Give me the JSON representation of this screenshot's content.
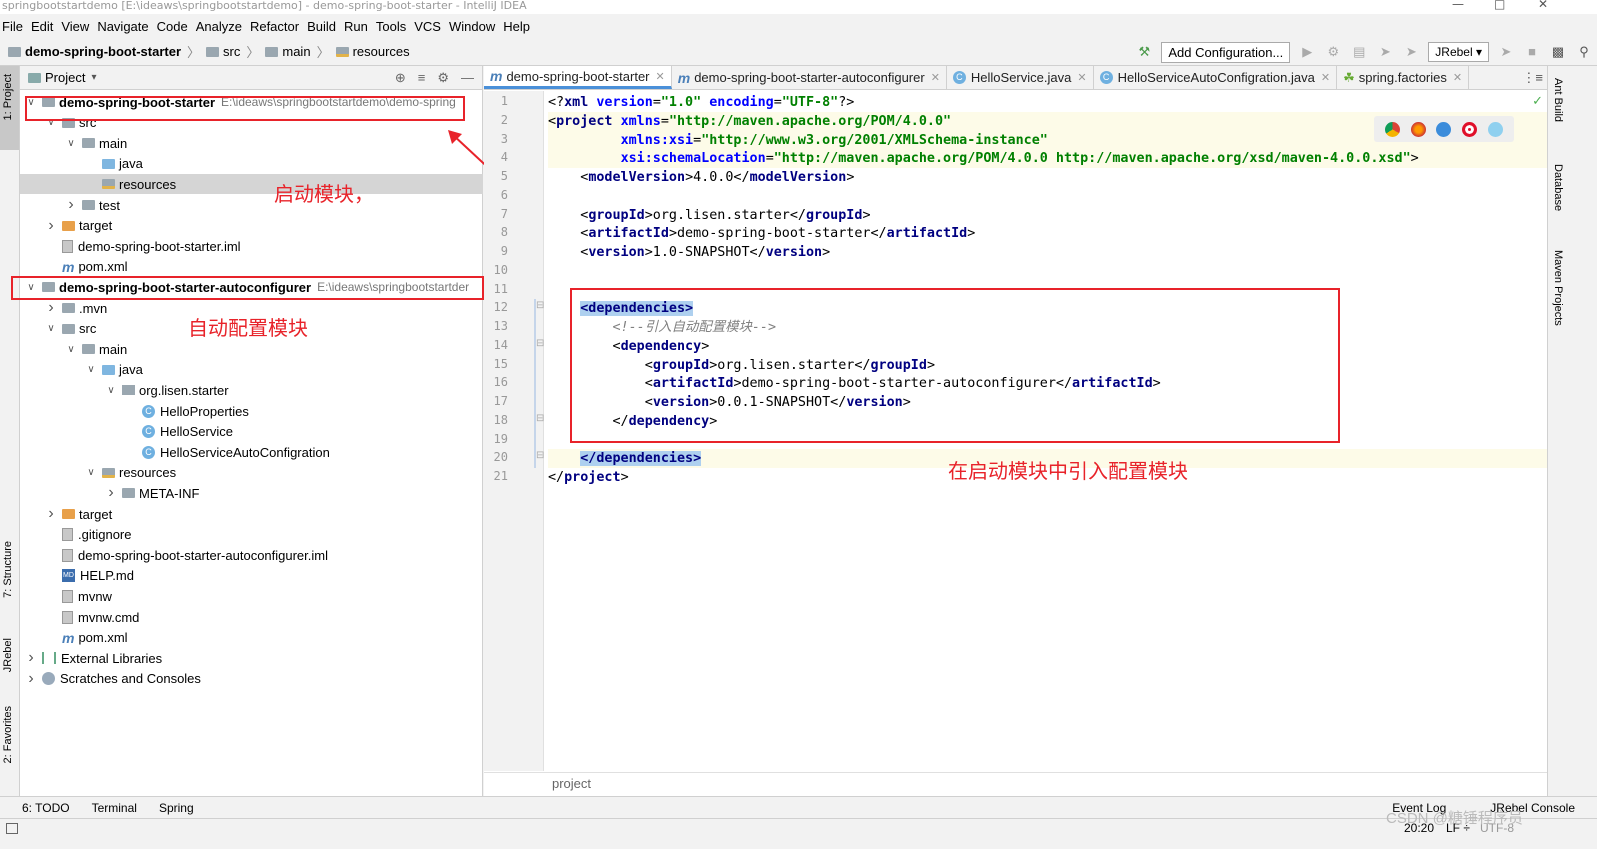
{
  "window": {
    "title": "springbootstartdemo [E:\\ideaws\\springbootstartdemo] - demo-spring-boot-starter - IntelliJ IDEA"
  },
  "menu": [
    "File",
    "Edit",
    "View",
    "Navigate",
    "Code",
    "Analyze",
    "Refactor",
    "Build",
    "Run",
    "Tools",
    "VCS",
    "Window",
    "Help"
  ],
  "breadcrumb": [
    "demo-spring-boot-starter",
    "src",
    "main",
    "resources"
  ],
  "toolbar": {
    "add_config": "Add Configuration...",
    "jrebel": "JRebel"
  },
  "side": {
    "project": "1: Project",
    "structure": "7: Structure",
    "jrebel": "JRebel",
    "favorites": "2: Favorites",
    "ant": "Ant Build",
    "database": "Database",
    "maven": "Maven Projects"
  },
  "project_panel": {
    "title": "Project"
  },
  "tree": [
    {
      "label": "demo-spring-boot-starter",
      "path": "E:\\ideaws\\springbootstartdemo\\demo-spring",
      "arrow": "v",
      "icon": "module",
      "bold": true
    },
    {
      "label": "src",
      "arrow": "v",
      "icon": "folder"
    },
    {
      "label": "main",
      "arrow": "v",
      "icon": "folder"
    },
    {
      "label": "java",
      "arrow": "",
      "icon": "folder-blue"
    },
    {
      "label": "resources",
      "arrow": "",
      "icon": "folder-res",
      "selected": true
    },
    {
      "label": "test",
      "arrow": ">",
      "icon": "folder"
    },
    {
      "label": "target",
      "arrow": ">",
      "icon": "folder-orange"
    },
    {
      "label": "demo-spring-boot-starter.iml",
      "arrow": "",
      "icon": "file"
    },
    {
      "label": "pom.xml",
      "arrow": "",
      "icon": "maven"
    },
    {
      "label": "demo-spring-boot-starter-autoconfigurer",
      "path": "E:\\ideaws\\springbootstartder",
      "arrow": "v",
      "icon": "module",
      "bold": true
    },
    {
      "label": ".mvn",
      "arrow": ">",
      "icon": "folder"
    },
    {
      "label": "src",
      "arrow": "v",
      "icon": "folder"
    },
    {
      "label": "main",
      "arrow": "v",
      "icon": "folder"
    },
    {
      "label": "java",
      "arrow": "v",
      "icon": "folder-blue"
    },
    {
      "label": "org.lisen.starter",
      "arrow": "v",
      "icon": "package"
    },
    {
      "label": "HelloProperties",
      "arrow": "",
      "icon": "class"
    },
    {
      "label": "HelloService",
      "arrow": "",
      "icon": "class"
    },
    {
      "label": "HelloServiceAutoConfigration",
      "arrow": "",
      "icon": "class"
    },
    {
      "label": "resources",
      "arrow": "v",
      "icon": "folder-res"
    },
    {
      "label": "META-INF",
      "arrow": ">",
      "icon": "folder"
    },
    {
      "label": "target",
      "arrow": ">",
      "icon": "folder-orange"
    },
    {
      "label": ".gitignore",
      "arrow": "",
      "icon": "file"
    },
    {
      "label": "demo-spring-boot-starter-autoconfigurer.iml",
      "arrow": "",
      "icon": "file"
    },
    {
      "label": "HELP.md",
      "arrow": "",
      "icon": "md"
    },
    {
      "label": "mvnw",
      "arrow": "",
      "icon": "file"
    },
    {
      "label": "mvnw.cmd",
      "arrow": "",
      "icon": "file"
    },
    {
      "label": "pom.xml",
      "arrow": "",
      "icon": "maven"
    },
    {
      "label": "External Libraries",
      "arrow": ">",
      "icon": "lib"
    },
    {
      "label": "Scratches and Consoles",
      "arrow": ">",
      "icon": "scratch"
    }
  ],
  "annotations": {
    "starter": "启动模块，",
    "autoconfig": "自动配置模块",
    "include": "在启动模块中引入配置模块"
  },
  "tabs": [
    {
      "label": "demo-spring-boot-starter",
      "icon": "maven",
      "active": true
    },
    {
      "label": "demo-spring-boot-starter-autoconfigurer",
      "icon": "maven"
    },
    {
      "label": "HelloService.java",
      "icon": "class"
    },
    {
      "label": "HelloServiceAutoConfigration.java",
      "icon": "class"
    },
    {
      "label": "spring.factories",
      "icon": "leaf"
    }
  ],
  "code_lines": [
    {
      "n": "1",
      "parts": [
        [
          "pi",
          "<?"
        ],
        [
          "tag",
          "xml "
        ],
        [
          "attr",
          "version"
        ],
        [
          "pi",
          "="
        ],
        [
          "val",
          "\"1.0\" "
        ],
        [
          "attr",
          "encoding"
        ],
        [
          "pi",
          "="
        ],
        [
          "val",
          "\"UTF-8\""
        ],
        [
          "pi",
          "?>"
        ]
      ]
    },
    {
      "n": "2",
      "parts": [
        [
          "pi",
          "<"
        ],
        [
          "tag",
          "project "
        ],
        [
          "attr",
          "xmlns"
        ],
        [
          "pi",
          "="
        ],
        [
          "val",
          "\"http://maven.apache.org/POM/4.0.0\""
        ]
      ]
    },
    {
      "n": "3",
      "parts": [
        [
          "pi",
          "         "
        ],
        [
          "attr",
          "xmlns:xsi"
        ],
        [
          "pi",
          "="
        ],
        [
          "val",
          "\"http://www.w3.org/2001/XMLSchema-instance\""
        ]
      ]
    },
    {
      "n": "4",
      "parts": [
        [
          "pi",
          "         "
        ],
        [
          "attr",
          "xsi:schemaLocation"
        ],
        [
          "pi",
          "="
        ],
        [
          "val",
          "\"http://maven.apache.org/POM/4.0.0 http://maven.apache.org/xsd/maven-4.0.0.xsd\""
        ],
        [
          "pi",
          ">"
        ]
      ]
    },
    {
      "n": "5",
      "parts": [
        [
          "pi",
          "    <"
        ],
        [
          "tag",
          "modelVersion"
        ],
        [
          "pi",
          ">4.0.0</"
        ],
        [
          "tag",
          "modelVersion"
        ],
        [
          "pi",
          ">"
        ]
      ]
    },
    {
      "n": "6",
      "parts": []
    },
    {
      "n": "7",
      "parts": [
        [
          "pi",
          "    <"
        ],
        [
          "tag",
          "groupId"
        ],
        [
          "pi",
          ">org.lisen.starter</"
        ],
        [
          "tag",
          "groupId"
        ],
        [
          "pi",
          ">"
        ]
      ]
    },
    {
      "n": "8",
      "parts": [
        [
          "pi",
          "    <"
        ],
        [
          "tag",
          "artifactId"
        ],
        [
          "pi",
          ">demo-spring-boot-starter</"
        ],
        [
          "tag",
          "artifactId"
        ],
        [
          "pi",
          ">"
        ]
      ]
    },
    {
      "n": "9",
      "parts": [
        [
          "pi",
          "    <"
        ],
        [
          "tag",
          "version"
        ],
        [
          "pi",
          ">1.0-SNAPSHOT</"
        ],
        [
          "tag",
          "version"
        ],
        [
          "pi",
          ">"
        ]
      ]
    },
    {
      "n": "10",
      "parts": []
    },
    {
      "n": "11",
      "parts": []
    },
    {
      "n": "12",
      "parts": [
        [
          "pi",
          "    "
        ],
        [
          "tagsel",
          "<dependencies>"
        ]
      ]
    },
    {
      "n": "13",
      "parts": [
        [
          "cmt",
          "        <!--引入自动配置模块-->"
        ]
      ]
    },
    {
      "n": "14",
      "parts": [
        [
          "pi",
          "        <"
        ],
        [
          "tag",
          "dependency"
        ],
        [
          "pi",
          ">"
        ]
      ]
    },
    {
      "n": "15",
      "parts": [
        [
          "pi",
          "            <"
        ],
        [
          "tag",
          "groupId"
        ],
        [
          "pi",
          ">org.lisen.starter</"
        ],
        [
          "tag",
          "groupId"
        ],
        [
          "pi",
          ">"
        ]
      ]
    },
    {
      "n": "16",
      "parts": [
        [
          "pi",
          "            <"
        ],
        [
          "tag",
          "artifactId"
        ],
        [
          "pi",
          ">demo-spring-boot-starter-autoconfigurer</"
        ],
        [
          "tag",
          "artifactId"
        ],
        [
          "pi",
          ">"
        ]
      ]
    },
    {
      "n": "17",
      "parts": [
        [
          "pi",
          "            <"
        ],
        [
          "tag",
          "version"
        ],
        [
          "pi",
          ">0.0.1-SNAPSHOT</"
        ],
        [
          "tag",
          "version"
        ],
        [
          "pi",
          ">"
        ]
      ]
    },
    {
      "n": "18",
      "parts": [
        [
          "pi",
          "        </"
        ],
        [
          "tag",
          "dependency"
        ],
        [
          "pi",
          ">"
        ]
      ]
    },
    {
      "n": "19",
      "parts": []
    },
    {
      "n": "20",
      "parts": [
        [
          "pi",
          "    "
        ],
        [
          "tagsel",
          "</dependencies>"
        ]
      ]
    },
    {
      "n": "21",
      "parts": [
        [
          "pi",
          "</"
        ],
        [
          "tag",
          "project"
        ],
        [
          "pi",
          ">"
        ]
      ]
    }
  ],
  "editor_breadcrumb": "project",
  "bottom_tools": [
    "6: TODO",
    "Terminal",
    "Spring"
  ],
  "bottom_right": [
    "Event Log",
    "JRebel Console"
  ],
  "status": {
    "position": "20:20",
    "line_sep": "LF ÷",
    "encoding": "UTF-8"
  },
  "watermark": "CSDN @糖锤程序员",
  "colors": {
    "annotation": "#e8232a",
    "tag": "#000080",
    "attr": "#0000ff",
    "value": "#008000",
    "selection": "#aed0ef"
  }
}
